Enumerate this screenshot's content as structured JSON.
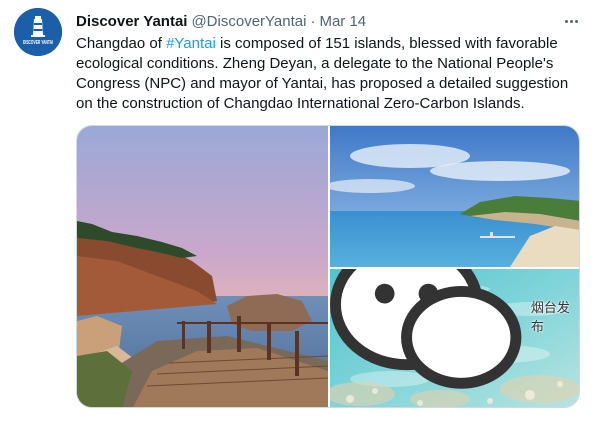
{
  "tweet": {
    "display_name": "Discover Yantai",
    "handle": "@DiscoverYantai",
    "separator": "·",
    "date": "Mar 14",
    "avatar_text": "DISCOVER YANTAI",
    "text_lines": [
      {
        "before": "Changdao of ",
        "hashtag": "#Yantai",
        "after": " is composed of 151 islands, blessed with favorable"
      },
      {
        "before": "ecological conditions. Zheng Deyan, a delegate to the National People's",
        "hashtag": "",
        "after": ""
      },
      {
        "before": "Congress (NPC) and mayor of Yantai, has proposed a detailed suggestion",
        "hashtag": "",
        "after": ""
      },
      {
        "before": "on the construction of Changdao International Zero-Carbon Islands.",
        "hashtag": "",
        "after": ""
      }
    ]
  },
  "media": {
    "watermark_text": "烟台发布"
  },
  "colors": {
    "accent": "#1d9bf0",
    "avatar_bg": "#1a5fa8",
    "text": "#0f1419",
    "muted": "#536471"
  }
}
